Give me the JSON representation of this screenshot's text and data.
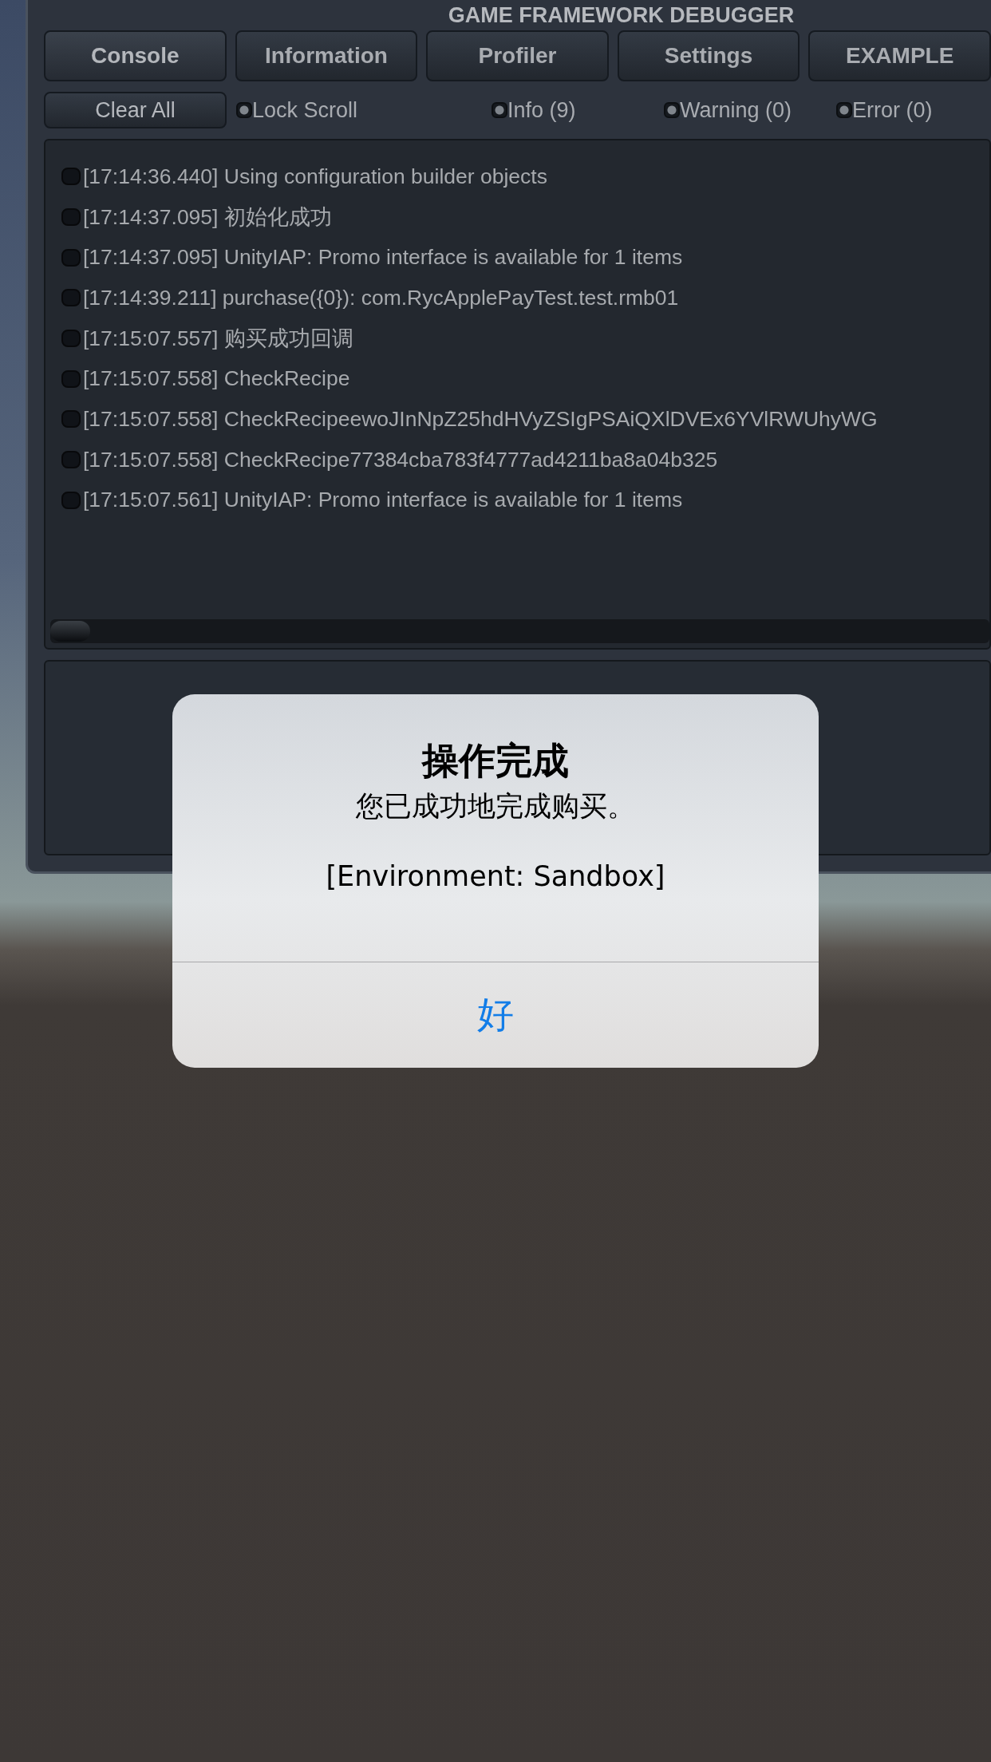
{
  "window": {
    "title": "GAME FRAMEWORK DEBUGGER"
  },
  "tabs": [
    {
      "label": "Console",
      "selected": true
    },
    {
      "label": "Information",
      "selected": false
    },
    {
      "label": "Profiler",
      "selected": false
    },
    {
      "label": "Settings",
      "selected": false
    },
    {
      "label": "EXAMPLE",
      "selected": false
    }
  ],
  "toolbar": {
    "clear_button": "Clear All",
    "toggles": [
      {
        "label": "Lock Scroll",
        "checked": true
      },
      {
        "label": "Info (9)",
        "checked": true
      },
      {
        "label": "Warning (0)",
        "checked": true
      },
      {
        "label": "Error (0)",
        "checked": true
      }
    ]
  },
  "log": [
    {
      "text": "[17:14:36.440] Using configuration builder objects",
      "selected": false
    },
    {
      "text": "[17:14:37.095] 初始化成功",
      "selected": false
    },
    {
      "text": "[17:14:37.095] UnityIAP: Promo interface is available for 1 items",
      "selected": false
    },
    {
      "text": "[17:14:39.211] purchase({0}): com.RycApplePayTest.test.rmb01",
      "selected": false
    },
    {
      "text": "[17:15:07.557] 购买成功回调",
      "selected": false
    },
    {
      "text": "[17:15:07.558] CheckRecipe",
      "selected": false
    },
    {
      "text": "[17:15:07.558] CheckRecipeewoJInNpZ25hdHVyZSIgPSAiQXlDVEx6YVlRWUhyWG",
      "selected": false
    },
    {
      "text": "[17:15:07.558] CheckRecipe77384cba783f4777ad4211ba8a04b325",
      "selected": false
    },
    {
      "text": "[17:15:07.561] UnityIAP: Promo interface is available for 1 items",
      "selected": false
    }
  ],
  "alert": {
    "title": "操作完成",
    "message": "您已成功地完成购买。",
    "detail": "[Environment: Sandbox]",
    "button": "好"
  }
}
